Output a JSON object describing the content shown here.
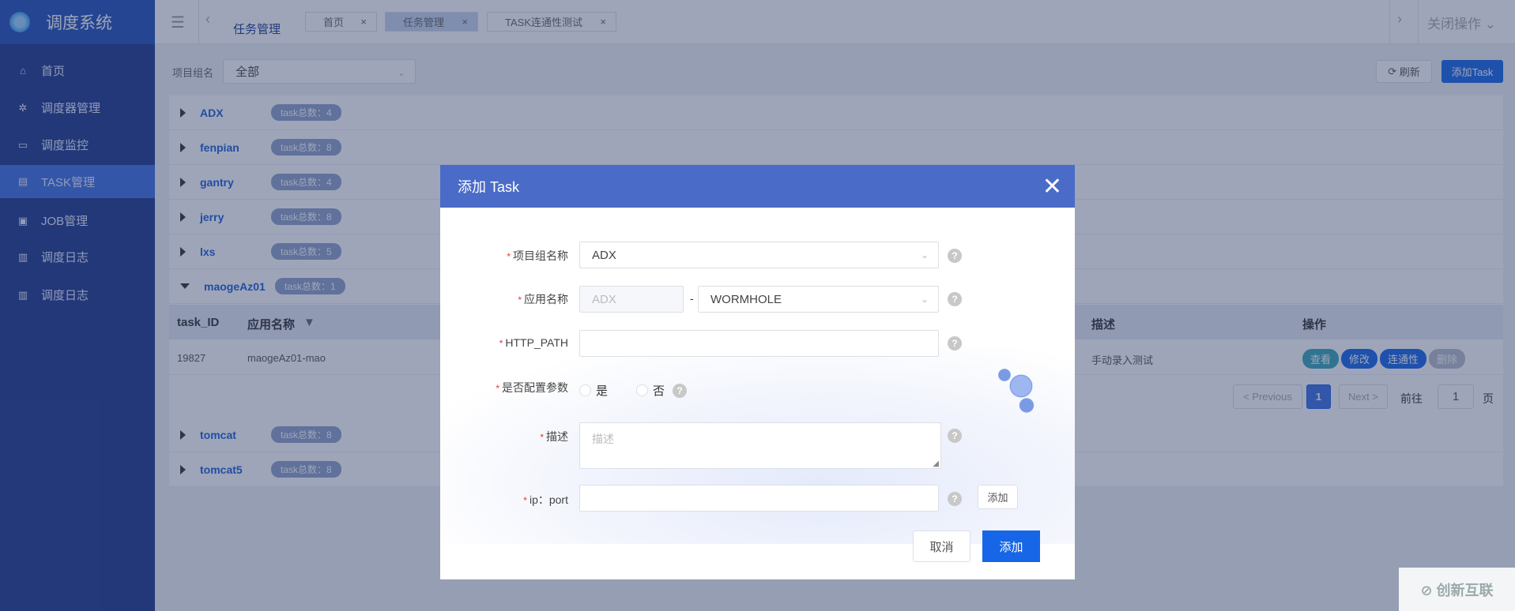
{
  "app": {
    "title": "调度系统"
  },
  "sidebar": {
    "items": [
      {
        "label": "首页",
        "icon": "home-icon"
      },
      {
        "label": "调度器管理",
        "icon": "scheduler-icon"
      },
      {
        "label": "调度监控",
        "icon": "monitor-icon"
      },
      {
        "label": "TASK管理",
        "icon": "document-icon",
        "active": true
      },
      {
        "label": "JOB管理",
        "icon": "job-icon"
      },
      {
        "label": "调度日志",
        "icon": "log-icon"
      },
      {
        "label": "调度日志",
        "icon": "log-icon"
      }
    ]
  },
  "header": {
    "breadcrumb": "任务管理",
    "tabs": [
      {
        "label": "首页"
      },
      {
        "label": "任务管理",
        "active": true
      },
      {
        "label": "TASK连通性测试"
      }
    ],
    "close_ops": "关闭操作"
  },
  "filter": {
    "label": "项目组名",
    "value": "全部",
    "refresh": "刷新",
    "add_task": "添加Task"
  },
  "groups": [
    {
      "name": "ADX",
      "count": "task总数：4"
    },
    {
      "name": "fenpian",
      "count": "task总数：8"
    },
    {
      "name": "gantry",
      "count": "task总数：4"
    },
    {
      "name": "jerry",
      "count": "task总数：8"
    },
    {
      "name": "lxs",
      "count": "task总数：5"
    },
    {
      "name": "maogeAz01",
      "count": "task总数：1",
      "expanded": true
    },
    {
      "name": "tomcat",
      "count": "task总数：8"
    },
    {
      "name": "tomcat5",
      "count": "task总数：8"
    }
  ],
  "table": {
    "headers": {
      "id": "task_ID",
      "app": "应用名称",
      "desc": "描述",
      "ops": "操作"
    },
    "rows": [
      {
        "id": "19827",
        "app": "maogeAz01-mao",
        "desc": "手动录入测试"
      }
    ],
    "actions": {
      "view": "查看",
      "edit": "修改",
      "conn": "连通性",
      "delete": "删除"
    }
  },
  "pagination": {
    "prev": "< Previous",
    "page": "1",
    "next": "Next >",
    "goto": "前往",
    "goto_value": "1",
    "unit": "页"
  },
  "modal": {
    "title": "添加 Task",
    "fields": {
      "group": {
        "label": "项目组名称",
        "value": "ADX"
      },
      "app": {
        "label": "应用名称",
        "prefix": "ADX",
        "sep": "-",
        "value": "WORMHOLE"
      },
      "path": {
        "label": "HTTP_PATH",
        "value": ""
      },
      "params": {
        "label": "是否配置参数",
        "yes": "是",
        "no": "否"
      },
      "desc": {
        "label": "描述",
        "placeholder": "描述"
      },
      "ipport": {
        "label": "ip：port",
        "add": "添加"
      }
    },
    "cancel": "取消",
    "submit": "添加"
  },
  "colors": {
    "sidebar": "#1f3a8a",
    "primary": "#1766e8",
    "modal_header": "#4a6cc8"
  }
}
